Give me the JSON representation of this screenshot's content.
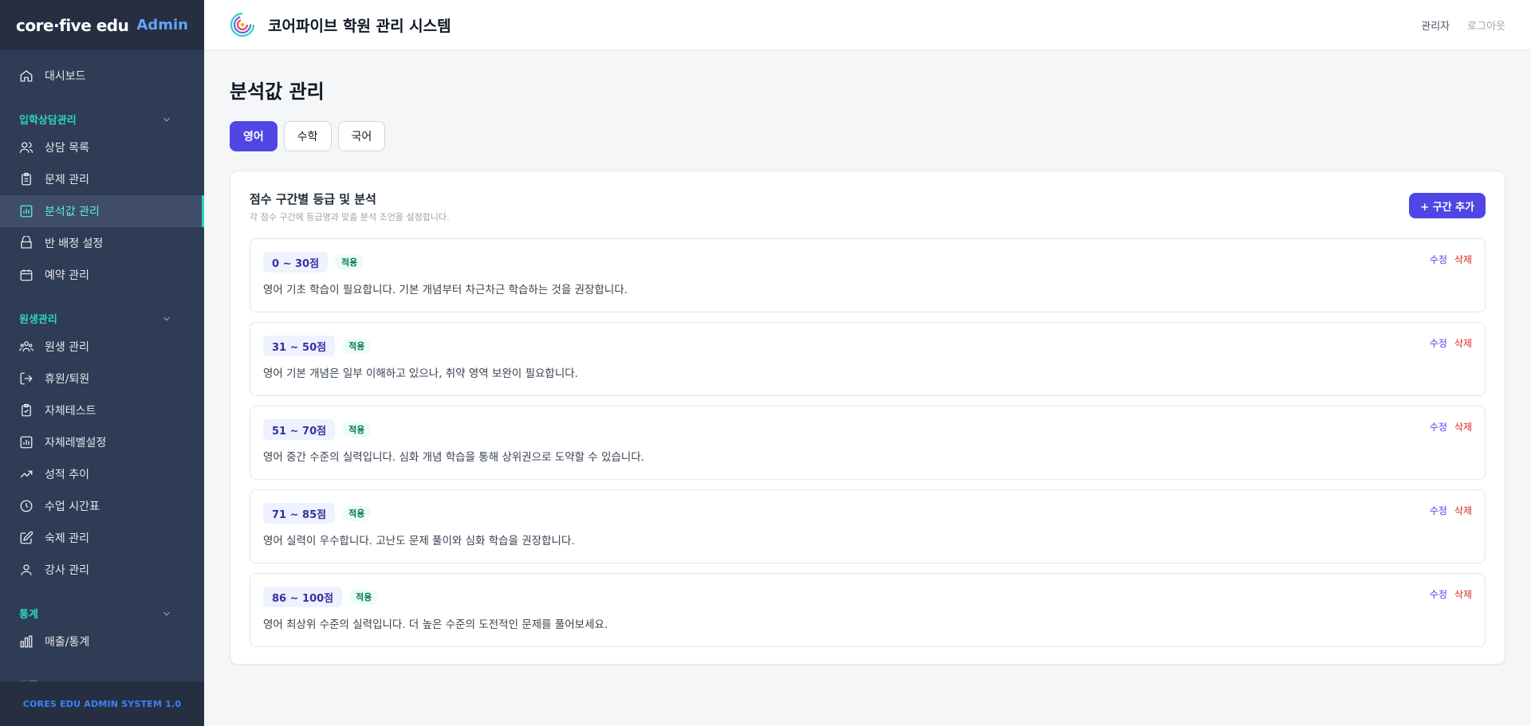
{
  "brand": {
    "logo_text": "core·five edu",
    "admin_label": "Admin"
  },
  "sidebar": {
    "dashboard": "대시보드",
    "sections": [
      {
        "label": "입학상담관리",
        "items": [
          "상담 목록",
          "문제 관리",
          "분석값 관리",
          "반 배정 설정",
          "예약 관리"
        ]
      },
      {
        "label": "원생관리",
        "items": [
          "원생 관리",
          "휴원/퇴원",
          "자체테스트",
          "자체레벨설정",
          "성적 추이",
          "수업 시간표",
          "숙제 관리",
          "강사 관리"
        ]
      },
      {
        "label": "통계",
        "items": [
          "매출/통계"
        ]
      },
      {
        "label": "도구",
        "items": []
      }
    ],
    "active_item": "분석값 관리",
    "footer": "CORES EDU ADMIN SYSTEM 1.0"
  },
  "header": {
    "title": "코어파이브 학원 관리 시스템",
    "user": "관리자",
    "logout": "로그아웃"
  },
  "page": {
    "title": "분석값 관리",
    "tabs": [
      "영어",
      "수학",
      "국어"
    ],
    "active_tab": "영어",
    "card": {
      "title": "점수 구간별 등급 및 분석",
      "subtitle": "각 점수 구간에 등급명과 맞춤 분석 조언을 설정합니다.",
      "add_button": "+ 구간 추가",
      "edit_label": "수정",
      "delete_label": "삭제",
      "ranges": [
        {
          "range": "0 ~ 30점",
          "status": "적용",
          "description": "영어 기초 학습이 필요합니다. 기본 개념부터 차근차근 학습하는 것을 권장합니다."
        },
        {
          "range": "31 ~ 50점",
          "status": "적용",
          "description": "영어 기본 개념은 일부 이해하고 있으나, 취약 영역 보완이 필요합니다."
        },
        {
          "range": "51 ~ 70점",
          "status": "적용",
          "description": "영어 중간 수준의 실력입니다. 심화 개념 학습을 통해 상위권으로 도약할 수 있습니다."
        },
        {
          "range": "71 ~ 85점",
          "status": "적용",
          "description": "영어 실력이 우수합니다. 고난도 문제 풀이와 심화 학습을 권장합니다."
        },
        {
          "range": "86 ~ 100점",
          "status": "적용",
          "description": "영어 최상위 수준의 실력입니다. 더 높은 수준의 도전적인 문제를 풀어보세요."
        }
      ]
    }
  },
  "colors": {
    "sidebar_bg": "#2f3c55",
    "accent_teal": "#2dd4bf",
    "primary": "#4f46e5",
    "danger": "#dc2626"
  }
}
